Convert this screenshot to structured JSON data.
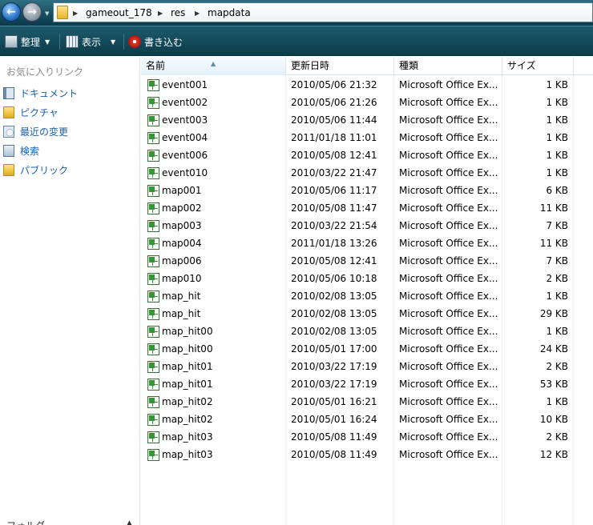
{
  "address": {
    "segments": [
      "gameout_178",
      "res",
      "mapdata"
    ]
  },
  "toolbar": {
    "organize_label": "整理",
    "views_label": "表示",
    "burn_label": "書き込む"
  },
  "nav": {
    "favorites_header": "お気に入りリンク",
    "items": [
      {
        "label": "ドキュメント",
        "icon": "documents-icon"
      },
      {
        "label": "ピクチャ",
        "icon": "folder-icon"
      },
      {
        "label": "最近の変更",
        "icon": "recent-icon"
      },
      {
        "label": "検索",
        "icon": "search-icon"
      },
      {
        "label": "パブリック",
        "icon": "folder-icon"
      }
    ],
    "folders_label": "フォルダ"
  },
  "columns": {
    "name": "名前",
    "date": "更新日時",
    "type": "種類",
    "size": "サイズ"
  },
  "files": [
    {
      "name": "event001",
      "date": "2010/05/06 21:32",
      "type": "Microsoft Office Ex...",
      "size": "1 KB"
    },
    {
      "name": "event002",
      "date": "2010/05/06 21:26",
      "type": "Microsoft Office Ex...",
      "size": "1 KB"
    },
    {
      "name": "event003",
      "date": "2010/05/06 11:44",
      "type": "Microsoft Office Ex...",
      "size": "1 KB"
    },
    {
      "name": "event004",
      "date": "2011/01/18 11:01",
      "type": "Microsoft Office Ex...",
      "size": "1 KB"
    },
    {
      "name": "event006",
      "date": "2010/05/08 12:41",
      "type": "Microsoft Office Ex...",
      "size": "1 KB"
    },
    {
      "name": "event010",
      "date": "2010/03/22 21:47",
      "type": "Microsoft Office Ex...",
      "size": "1 KB"
    },
    {
      "name": "map001",
      "date": "2010/05/06 11:17",
      "type": "Microsoft Office Ex...",
      "size": "6 KB"
    },
    {
      "name": "map002",
      "date": "2010/05/08 11:47",
      "type": "Microsoft Office Ex...",
      "size": "11 KB"
    },
    {
      "name": "map003",
      "date": "2010/03/22 21:54",
      "type": "Microsoft Office Ex...",
      "size": "7 KB"
    },
    {
      "name": "map004",
      "date": "2011/01/18 13:26",
      "type": "Microsoft Office Ex...",
      "size": "11 KB"
    },
    {
      "name": "map006",
      "date": "2010/05/08 12:41",
      "type": "Microsoft Office Ex...",
      "size": "7 KB"
    },
    {
      "name": "map010",
      "date": "2010/05/06 10:18",
      "type": "Microsoft Office Ex...",
      "size": "2 KB"
    },
    {
      "name": "map_hit",
      "date": "2010/02/08 13:05",
      "type": "Microsoft Office Ex...",
      "size": "1 KB"
    },
    {
      "name": "map_hit",
      "date": "2010/02/08 13:05",
      "type": "Microsoft Office Ex...",
      "size": "29 KB"
    },
    {
      "name": "map_hit00",
      "date": "2010/02/08 13:05",
      "type": "Microsoft Office Ex...",
      "size": "1 KB"
    },
    {
      "name": "map_hit00",
      "date": "2010/05/01 17:00",
      "type": "Microsoft Office Ex...",
      "size": "24 KB"
    },
    {
      "name": "map_hit01",
      "date": "2010/03/22 17:19",
      "type": "Microsoft Office Ex...",
      "size": "2 KB"
    },
    {
      "name": "map_hit01",
      "date": "2010/03/22 17:19",
      "type": "Microsoft Office Ex...",
      "size": "53 KB"
    },
    {
      "name": "map_hit02",
      "date": "2010/05/01 16:21",
      "type": "Microsoft Office Ex...",
      "size": "1 KB"
    },
    {
      "name": "map_hit02",
      "date": "2010/05/01 16:24",
      "type": "Microsoft Office Ex...",
      "size": "10 KB"
    },
    {
      "name": "map_hit03",
      "date": "2010/05/08 11:49",
      "type": "Microsoft Office Ex...",
      "size": "2 KB"
    },
    {
      "name": "map_hit03",
      "date": "2010/05/08 11:49",
      "type": "Microsoft Office Ex...",
      "size": "12 KB"
    }
  ],
  "colors": {
    "toolbar_bg": "#124858",
    "nav_link": "#1a5fa8"
  }
}
